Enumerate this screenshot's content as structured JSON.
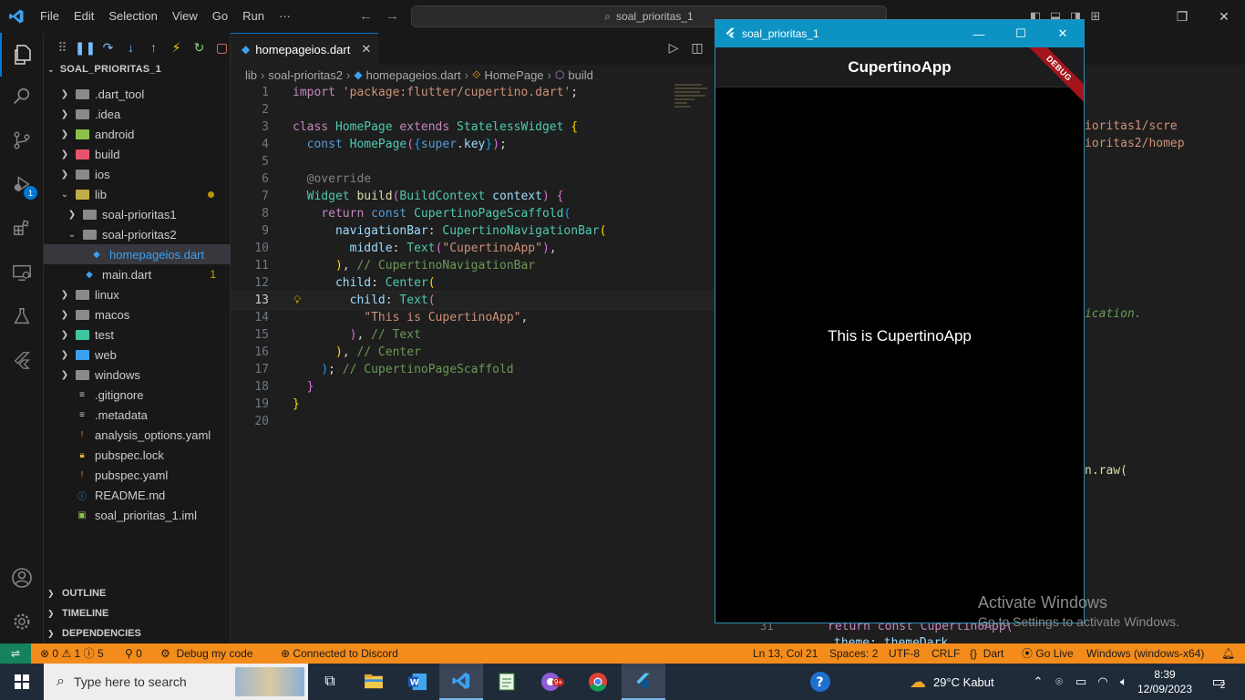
{
  "titlebar": {
    "menus": [
      "File",
      "Edit",
      "Selection",
      "View",
      "Go",
      "Run",
      "···"
    ],
    "search_text": "soal_prioritas_1"
  },
  "activity_bar": {
    "icons": [
      "explorer-icon",
      "search-icon",
      "source-control-icon",
      "run-debug-icon",
      "extensions-icon",
      "remote-explorer-icon",
      "testing-icon",
      "flutter-icon",
      "account-icon",
      "settings-gear-icon"
    ],
    "debug_badge": "1"
  },
  "explorer": {
    "root": "SOAL_PRIORITAS_1",
    "items": [
      {
        "label": ".dart_tool",
        "type": "folder",
        "depth": 0,
        "state": "collapsed"
      },
      {
        "label": ".idea",
        "type": "folder",
        "depth": 0,
        "state": "collapsed"
      },
      {
        "label": "android",
        "type": "folder",
        "depth": 0,
        "state": "collapsed"
      },
      {
        "label": "build",
        "type": "folder",
        "depth": 0,
        "state": "collapsed"
      },
      {
        "label": "ios",
        "type": "folder",
        "depth": 0,
        "state": "collapsed"
      },
      {
        "label": "lib",
        "type": "folder",
        "depth": 0,
        "state": "expanded",
        "dot": true
      },
      {
        "label": "soal-prioritas1",
        "type": "folder",
        "depth": 1,
        "state": "collapsed"
      },
      {
        "label": "soal-prioritas2",
        "type": "folder",
        "depth": 1,
        "state": "expanded"
      },
      {
        "label": "homepageios.dart",
        "type": "dart",
        "depth": 2,
        "selected": true
      },
      {
        "label": "main.dart",
        "type": "dart",
        "depth": 1,
        "count": "1"
      },
      {
        "label": "linux",
        "type": "folder",
        "depth": 0,
        "state": "collapsed"
      },
      {
        "label": "macos",
        "type": "folder",
        "depth": 0,
        "state": "collapsed"
      },
      {
        "label": "test",
        "type": "folder",
        "depth": 0,
        "state": "collapsed"
      },
      {
        "label": "web",
        "type": "folder",
        "depth": 0,
        "state": "collapsed"
      },
      {
        "label": "windows",
        "type": "folder",
        "depth": 0,
        "state": "collapsed"
      },
      {
        "label": ".gitignore",
        "type": "file",
        "depth": 0
      },
      {
        "label": ".metadata",
        "type": "file",
        "depth": 0
      },
      {
        "label": "analysis_options.yaml",
        "type": "yaml",
        "depth": 0
      },
      {
        "label": "pubspec.lock",
        "type": "lock",
        "depth": 0
      },
      {
        "label": "pubspec.yaml",
        "type": "yaml",
        "depth": 0
      },
      {
        "label": "README.md",
        "type": "md",
        "depth": 0
      },
      {
        "label": "soal_prioritas_1.iml",
        "type": "iml",
        "depth": 0
      }
    ],
    "sections": [
      "OUTLINE",
      "TIMELINE",
      "DEPENDENCIES"
    ]
  },
  "editor": {
    "tab_label": "homepageios.dart",
    "breadcrumb": [
      "lib",
      "soal-prioritas2",
      "homepageios.dart",
      "HomePage",
      "build"
    ],
    "current_line": 13,
    "lines": [
      "import 'package:flutter/cupertino.dart';",
      "",
      "class HomePage extends StatelessWidget {",
      "  const HomePage({super.key});",
      "",
      "  @override",
      "  Widget build(BuildContext context) {",
      "    return const CupertinoPageScaffold(",
      "      navigationBar: CupertinoNavigationBar(",
      "        middle: Text(\"CupertinoApp\"),",
      "      ), // CupertinoNavigationBar",
      "      child: Center(",
      "        child: Text(",
      "          \"This is CupertinoApp\",",
      "        ), // Text",
      "      ), // Center",
      "    ); // CupertinoPageScaffold",
      "  }",
      "}",
      ""
    ]
  },
  "background_editor": {
    "fragments": [
      "ioritas1/scre",
      "ioritas2/homep",
      "ication.",
      "n.raw(",
      "31",
      "return const CupertinoApp(",
      "theme: themeDark"
    ]
  },
  "flutter_app": {
    "window_title": "soal_prioritas_1",
    "nav_title": "CupertinoApp",
    "debug_banner": "DEBUG",
    "body_text": "This is CupertinoApp"
  },
  "watermark": {
    "line1": "Activate Windows",
    "line2": "Go to Settings to activate Windows."
  },
  "statusbar": {
    "errors": "0",
    "warnings": "1",
    "info": "5",
    "ports": "0",
    "debug": "Debug my code",
    "discord": "Connected to Discord",
    "cursor": "Ln 13, Col 21",
    "spaces": "Spaces: 2",
    "encoding": "UTF-8",
    "eol": "CRLF",
    "language": "Dart",
    "golive": "Go Live",
    "device": "Windows (windows-x64)"
  },
  "taskbar": {
    "search_placeholder": "Type here to search",
    "weather": "29°C  Kabut",
    "time": "8:39",
    "date": "12/09/2023",
    "notifications": "2",
    "chrome_badge": "9+"
  }
}
